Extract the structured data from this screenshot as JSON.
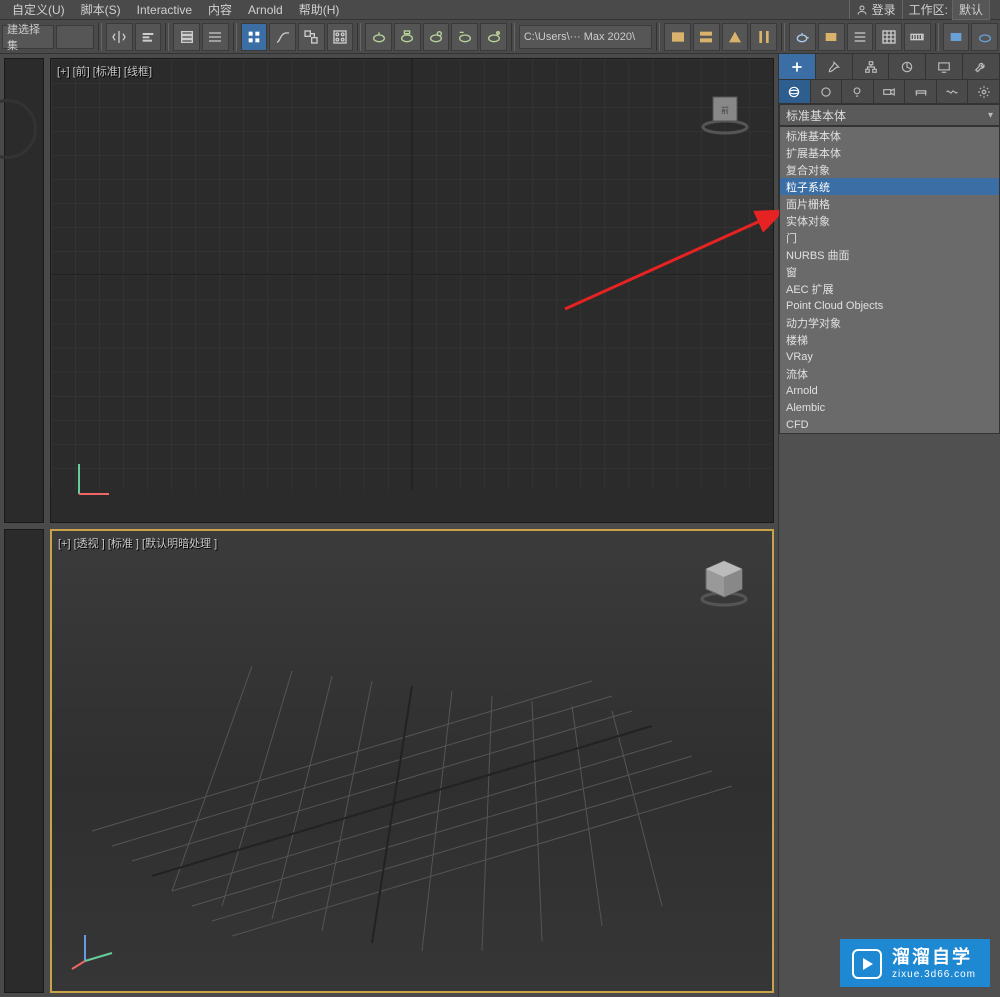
{
  "menubar": {
    "items": [
      "自定义(U)",
      "脚本(S)",
      "Interactive",
      "内容",
      "Arnold",
      "帮助(H)"
    ],
    "login_label": "登录",
    "workspace_label": "工作区:",
    "workspace_value": "默认"
  },
  "toolbar": {
    "selection_set_label": "建选择集",
    "path": "C:\\Users\\··· Max 2020\\"
  },
  "viewports": {
    "front_label": "[+] [前] [标准] [线框]",
    "persp_label": "[+] [透视 ] [标准 ] [默认明暗处理 ]"
  },
  "command_panel": {
    "dropdown_selected": "标准基本体",
    "dropdown_items": [
      "标准基本体",
      "扩展基本体",
      "复合对象",
      "粒子系统",
      "面片栅格",
      "实体对象",
      "门",
      "NURBS 曲面",
      "窗",
      "AEC 扩展",
      "Point Cloud Objects",
      "动力学对象",
      "楼梯",
      "VRay",
      "流体",
      "Arnold",
      "Alembic",
      "CFD"
    ],
    "highlight_index": 3
  },
  "watermark": {
    "main": "溜溜自学",
    "sub": "zixue.3d66.com"
  },
  "icons": {
    "plus": "plus-icon",
    "modify": "modify-icon",
    "hierarchy": "hierarchy-icon",
    "motion": "motion-icon",
    "display": "display-icon",
    "utility": "utility-icon",
    "sphere": "sphere-icon",
    "shapes": "shapes-icon",
    "light": "light-icon",
    "camera": "camera-icon",
    "helper": "helper-icon",
    "space": "space-icon",
    "system": "system-icon"
  }
}
